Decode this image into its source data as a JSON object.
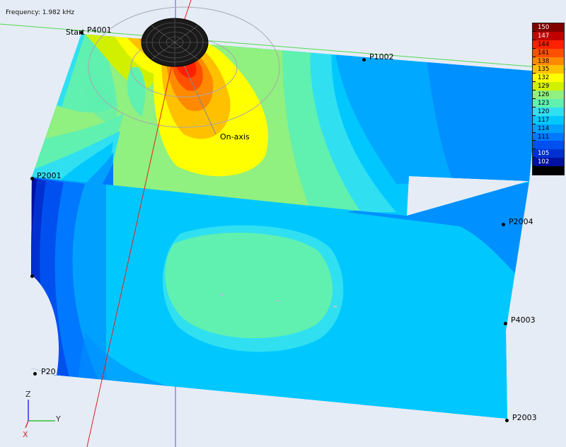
{
  "frequency_label": "Frequency: 1.982 kHz",
  "on_axis_label": "On-axis",
  "start_label": "Start",
  "points": [
    {
      "name": "P4001"
    },
    {
      "name": "P1002"
    },
    {
      "name": "P2001"
    },
    {
      "name": "P2004"
    },
    {
      "name": "P4003"
    },
    {
      "name": "P2003"
    },
    {
      "name": "P20"
    }
  ],
  "legend": {
    "ticks": [
      "150",
      "147",
      "144",
      "141",
      "138",
      "135",
      "132",
      "129",
      "126",
      "123",
      "120",
      "117",
      "114",
      "111",
      "",
      "105",
      "102",
      ""
    ],
    "colors": [
      "#800000",
      "#c00000",
      "#ff2000",
      "#ff5000",
      "#ff8a00",
      "#ffc000",
      "#ffff00",
      "#d0f000",
      "#90f080",
      "#60f0b0",
      "#30e0f0",
      "#00c8ff",
      "#00a0ff",
      "#0078ff",
      "#0050f0",
      "#0030d0",
      "#0010a0",
      "#000000"
    ]
  },
  "axes": {
    "z": "Z",
    "y": "Y",
    "x": "X"
  },
  "edge_glyph": "4"
}
